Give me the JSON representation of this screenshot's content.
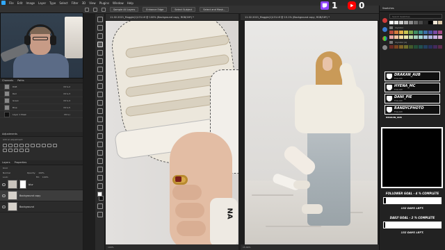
{
  "menubar": {
    "items": [
      "File",
      "Edit",
      "Image",
      "Layer",
      "Type",
      "Select",
      "Filter",
      "3D",
      "View",
      "Plugins",
      "Window",
      "Help"
    ]
  },
  "options": {
    "sample_all_layers": "Sample All Layers",
    "enhance_edge": "Enhance Edge",
    "select_subject": "Select Subject",
    "select_and_mask": "Select and Mask..."
  },
  "stream": {
    "twitch_count": "1",
    "youtube_count": "0",
    "twitch_color": "#9146ff",
    "youtube_color": "#ff0000"
  },
  "documents": {
    "left_tab": "11.02.2021_Muggle(1)131.tif @ 100% (Background copy, RGB/16*) *",
    "right_tab": "11.02.2021_Muggle(1)131.tif @ 15.1% (Background copy, RGB/16*) *",
    "left_zoom": "100%",
    "right_zoom": "15.09%",
    "shoe_text": "NA"
  },
  "left_panel": {
    "channels_tab": "Channels",
    "paths_tab": "Paths",
    "channels": [
      {
        "name": "RGB",
        "shortcut": "Ctrl+2"
      },
      {
        "name": "Red",
        "shortcut": "Ctrl+3"
      },
      {
        "name": "Green",
        "shortcut": "Ctrl+4"
      },
      {
        "name": "Blue",
        "shortcut": "Ctrl+5"
      },
      {
        "name": "Layer 1 Mask",
        "shortcut": "Ctrl+\\"
      }
    ],
    "adjustments_tab": "Adjustments",
    "add_adjustment": "Add an adjustment",
    "layers_tab": "Layers",
    "properties_tab": "Properties",
    "kind_label": "Kind",
    "blend_mode": "Normal",
    "opacity_label": "Opacity:",
    "opacity_value": "100%",
    "lock_label": "Lock:",
    "fill_label": "Fill:",
    "fill_value": "100%",
    "layers": [
      {
        "name": "blur",
        "selected": false
      },
      {
        "name": "Background copy",
        "selected": true
      },
      {
        "name": "Background",
        "selected": false
      }
    ]
  },
  "right_panel": {
    "tab": "Swatches",
    "search_placeholder": "Search Swatches",
    "group1": "mycolor",
    "group2": "mycolor (1)",
    "swatch_colors_row1": [
      "#ffffff",
      "#e8e8e8",
      "#cfcfcf",
      "#b0b0b0",
      "#8c8c8c",
      "#6a6a6a",
      "#4a4a4a",
      "#2b2b2b",
      "#000000",
      "#f2e9d8",
      "#d9c7a7"
    ],
    "swatch_colors_row2": [
      "#b84a3d",
      "#d47a3c",
      "#e2b24a",
      "#c9c650",
      "#7aa64b",
      "#3f8d62",
      "#3a8c8c",
      "#3c6ea8",
      "#4a52a3",
      "#7a4aa3",
      "#a34a86"
    ],
    "swatch_colors_row3": [
      "#e6a5a5",
      "#f0c2a0",
      "#f5dfa3",
      "#e8e6ac",
      "#bcd8a9",
      "#a5d1bb",
      "#a6d4d4",
      "#a6bfe0",
      "#aeb2de",
      "#c6aee0",
      "#e0aed2"
    ],
    "swatch_colors_row4": [
      "#6b2a24",
      "#7a4420",
      "#7d6226",
      "#6f6d2c",
      "#41592b",
      "#234f37",
      "#214f4f",
      "#22405f",
      "#2a2f5c",
      "#432a5c",
      "#5c2a4b"
    ]
  },
  "overlay": {
    "followers": [
      {
        "name": "DRAKAN_AUB",
        "tag": "FOLLOW"
      },
      {
        "name": "HYENA_MC",
        "tag": "FOLLOW"
      },
      {
        "name": "DANI_PIE",
        "tag": "FOLLOW"
      },
      {
        "name": "RANDYCPHOTO",
        "tag": "FOLLOW"
      }
    ],
    "latest_label": "DRAKAN_AUB",
    "follower_goal": "FOLLOWER GOAL - 4 % COMPLETE",
    "follower_goal_fraction": 0.04,
    "follower_days": "132 DAYS LEFT.",
    "daily_goal": "DAILY GOAL - 2 % COMPLETE",
    "daily_goal_fraction": 0.02,
    "daily_days": "132 DAYS LEFT."
  }
}
